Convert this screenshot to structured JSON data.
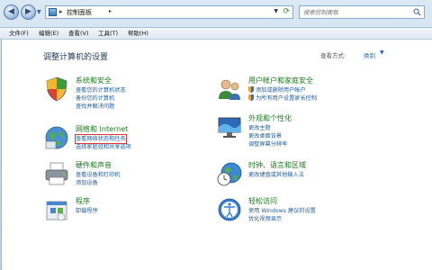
{
  "address": {
    "path": "控制面板",
    "search_placeholder": "搜索控制面板"
  },
  "menu": [
    {
      "label": "文件(F)"
    },
    {
      "label": "编辑(E)"
    },
    {
      "label": "查看(V)"
    },
    {
      "label": "工具(T)"
    },
    {
      "label": "帮助(H)"
    }
  ],
  "page": {
    "title": "调整计算机的设置",
    "view_by_label": "查看方式:",
    "view_by_value": "类别"
  },
  "categories": [
    {
      "title": "系统和安全",
      "icon": "shield-icon",
      "links": [
        "查看您的计算机状态",
        "备份您的计算机",
        "查找并解决问题"
      ]
    },
    {
      "title": "网络和 Internet",
      "icon": "network-icon",
      "links": [
        "查看网络状态和任务",
        "选择家庭组和共享选项"
      ]
    },
    {
      "title": "硬件和声音",
      "icon": "printer-icon",
      "links": [
        "查看设备和打印机",
        "添加设备"
      ]
    },
    {
      "title": "程序",
      "icon": "programs-icon",
      "links": [
        "卸载程序"
      ]
    },
    {
      "title": "用户帐户和家庭安全",
      "icon": "users-icon",
      "links": [
        "添加或删除用户帐户",
        "为所有用户设置家长控制"
      ]
    },
    {
      "title": "外观和个性化",
      "icon": "display-icon",
      "links": [
        "更改主题",
        "更改桌面背景",
        "调整屏幕分辨率"
      ]
    },
    {
      "title": "时钟、语言和区域",
      "icon": "globe-clock-icon",
      "links": [
        "更改键盘或其他输入法"
      ]
    },
    {
      "title": "轻松访问",
      "icon": "accessibility-icon",
      "links": [
        "使用 Windows 建议的设置",
        "优化视频显示"
      ]
    }
  ],
  "colors": {
    "category_title": "#1a7a1a",
    "link": "#1f5fa8",
    "highlight": "#e03333"
  }
}
